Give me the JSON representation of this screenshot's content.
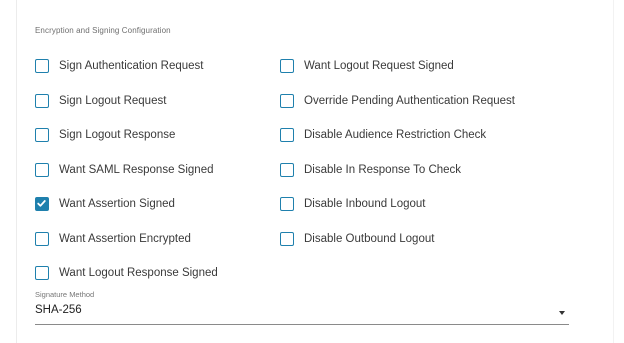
{
  "section": {
    "title": "Encryption and Signing Configuration"
  },
  "options_left": [
    {
      "label": "Sign Authentication Request",
      "checked": false
    },
    {
      "label": "Sign Logout Request",
      "checked": false
    },
    {
      "label": "Sign Logout Response",
      "checked": false
    },
    {
      "label": "Want SAML Response Signed",
      "checked": false
    },
    {
      "label": "Want Assertion Signed",
      "checked": true
    },
    {
      "label": "Want Assertion Encrypted",
      "checked": false
    },
    {
      "label": "Want Logout Response Signed",
      "checked": false
    }
  ],
  "options_right": [
    {
      "label": "Want Logout Request Signed",
      "checked": false
    },
    {
      "label": "Override Pending Authentication Request",
      "checked": false
    },
    {
      "label": "Disable Audience Restriction Check",
      "checked": false
    },
    {
      "label": "Disable In Response To Check",
      "checked": false
    },
    {
      "label": "Disable Inbound Logout",
      "checked": false
    },
    {
      "label": "Disable Outbound Logout",
      "checked": false
    }
  ],
  "signature_method": {
    "label": "Signature Method",
    "value": "SHA-256",
    "icon": "caret-down-icon"
  },
  "colors": {
    "checkbox_accent": "#1f80ad"
  }
}
